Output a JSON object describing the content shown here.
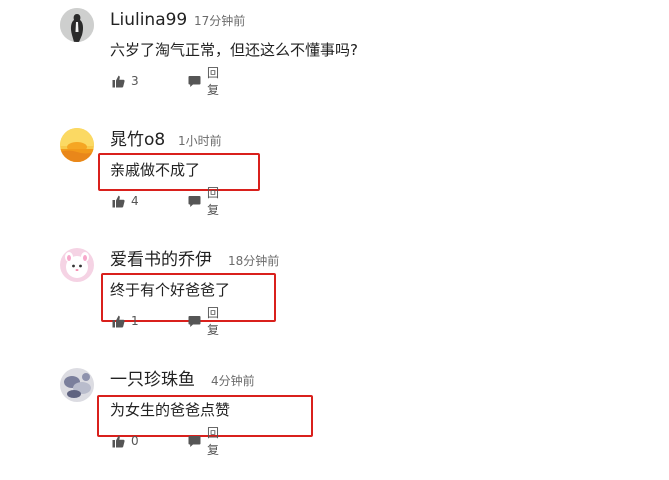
{
  "comments": [
    {
      "username": "Liulina99",
      "time": "17分钟前",
      "text": "六岁了淘气正常，但还这么不懂事吗?",
      "likes": "3",
      "reply_label": "回复",
      "highlighted": false
    },
    {
      "username": "晁竹o8",
      "time": "1小时前",
      "text": "亲戚做不成了",
      "likes": "4",
      "reply_label": "回复",
      "highlighted": true
    },
    {
      "username": "爱看书的乔伊",
      "time": "18分钟前",
      "text": "终于有个好爸爸了",
      "likes": "1",
      "reply_label": "回复",
      "highlighted": true
    },
    {
      "username": "一只珍珠鱼",
      "time": "4分钟前",
      "text": "为女生的爸爸点赞",
      "likes": "0",
      "reply_label": "回复",
      "highlighted": true
    }
  ],
  "colors": {
    "highlight": "#d9201c",
    "text": "#222222",
    "muted": "#6b6b6b"
  }
}
